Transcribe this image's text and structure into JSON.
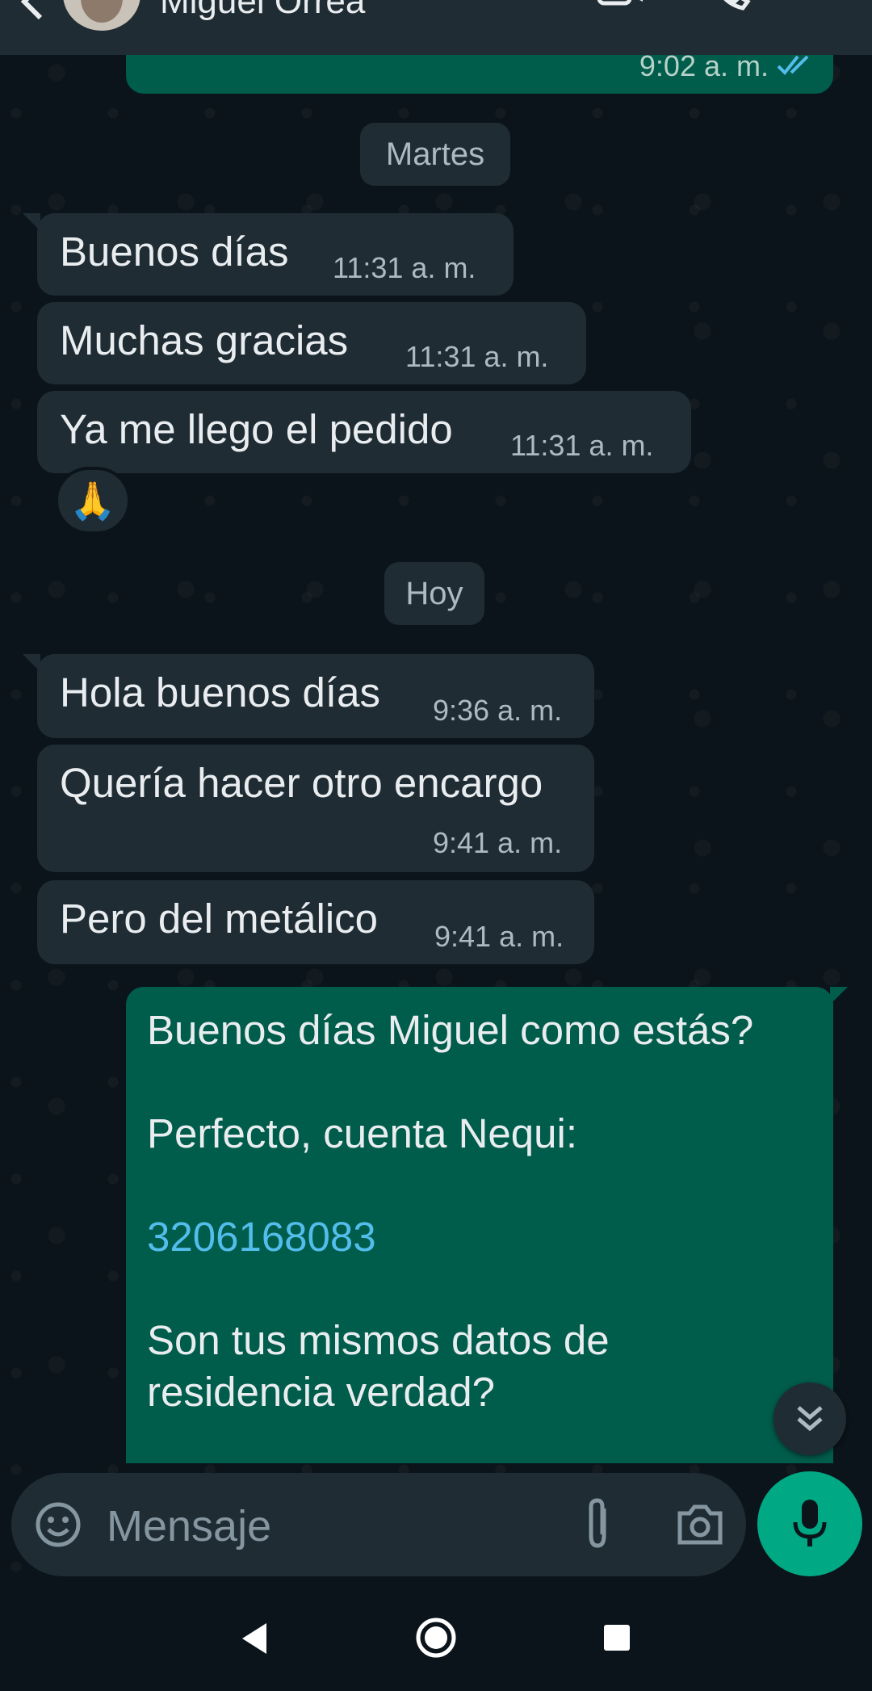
{
  "header": {
    "contact_name": "Miguel Orrea"
  },
  "top_message": {
    "time": "9:02 a. m."
  },
  "day_separators": [
    "Martes",
    "Hoy"
  ],
  "incoming": [
    {
      "text": "Buenos días",
      "time": "11:31 a. m."
    },
    {
      "text": "Muchas gracias",
      "time": "11:31 a. m."
    },
    {
      "text": "Ya me llego el pedido",
      "time": "11:31 a. m."
    },
    {
      "text": "Hola buenos días",
      "time": "9:36 a. m."
    },
    {
      "text": "Quería hacer otro encargo",
      "time": "9:41 a. m."
    },
    {
      "text": "Pero del metálico",
      "time": "9:41 a. m."
    }
  ],
  "reaction": "🙏",
  "outgoing": {
    "line1": "Buenos días Miguel como estás?",
    "line2": "Perfecto, cuenta Nequi:",
    "phone_link": "3206168083",
    "line3": "Son tus mismos datos de",
    "line4": "residencia verdad?"
  },
  "input": {
    "placeholder": "Mensaje"
  },
  "colors": {
    "background": "#0b141a",
    "incoming_bubble": "#1f2c34",
    "outgoing_bubble": "#005c4b",
    "accent": "#00a884",
    "link": "#53bdeb",
    "read_ticks": "#53bdeb"
  }
}
